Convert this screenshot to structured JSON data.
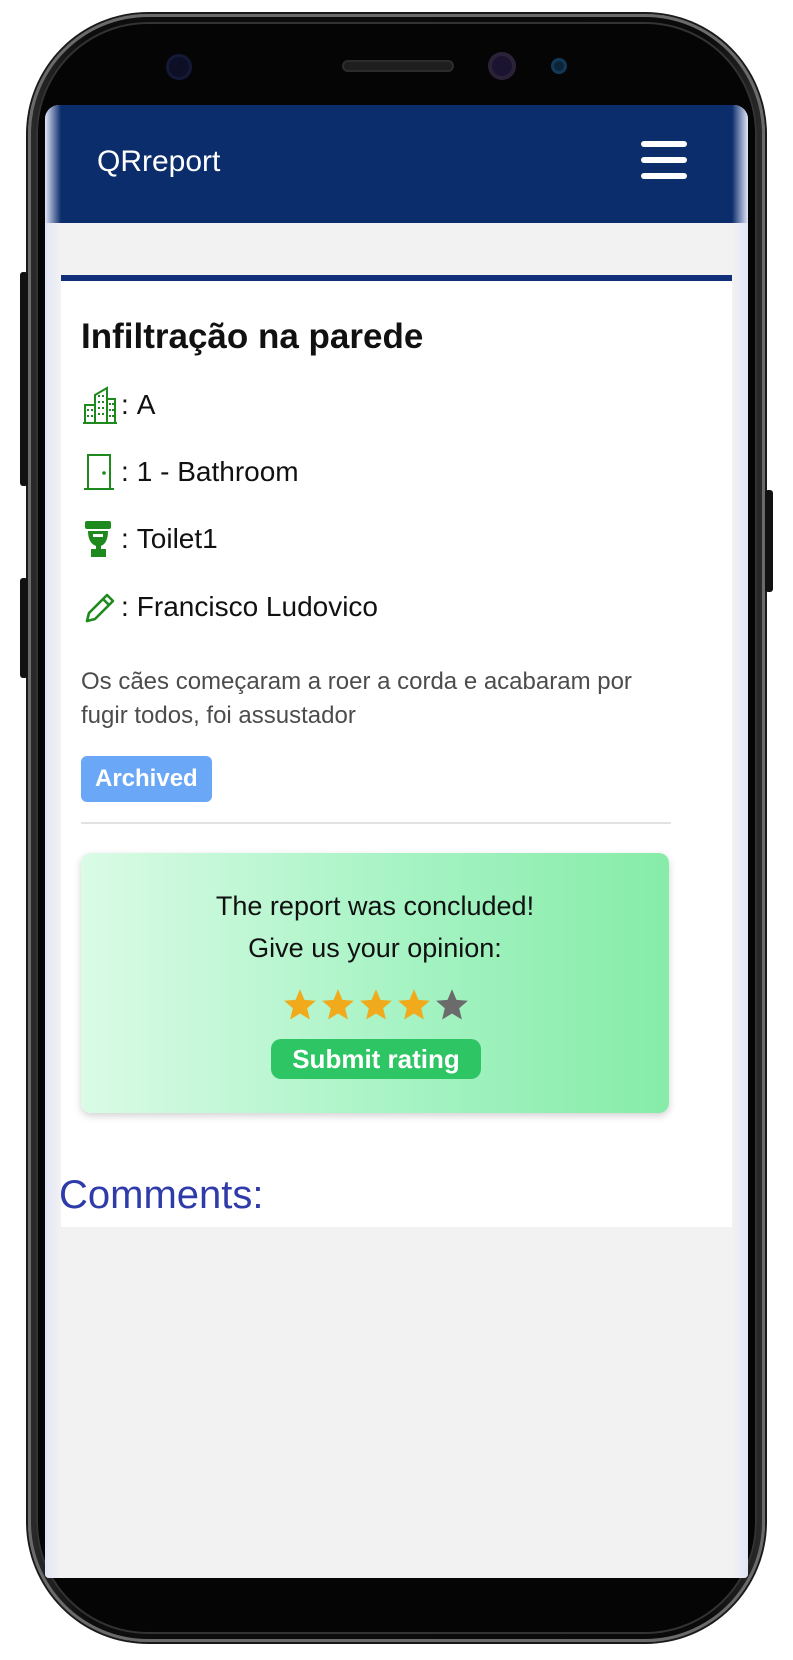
{
  "navbar": {
    "brand": "QRreport",
    "menu_icon": "hamburger-menu-icon"
  },
  "report": {
    "title": "Infiltração na parede",
    "fields": [
      {
        "icon": "building-icon",
        "separator": ":",
        "value": "A"
      },
      {
        "icon": "door-icon",
        "separator": ":",
        "value": "1 - Bathroom"
      },
      {
        "icon": "toilet-icon",
        "separator": ":",
        "value": "Toilet1"
      },
      {
        "icon": "pencil-icon",
        "separator": ":",
        "value": "Francisco Ludovico"
      }
    ],
    "description": "Os cães começaram a roer a corda e acabaram por fugir todos, foi assustador",
    "status": "Archived"
  },
  "rating": {
    "line1": "The report was concluded!",
    "line2": "Give us your opinion:",
    "stars_selected": 4,
    "stars_total": 5,
    "submit_label": "Submit rating"
  },
  "comments": {
    "title": "Comments:"
  },
  "colors": {
    "navbar": "#0c2d6c",
    "accent_border": "#12307a",
    "icon_green": "#1e8a1e",
    "badge_blue": "#6aa8f7",
    "star_filled": "#f0aa1c",
    "star_empty": "#6b6b6b",
    "submit_green": "#2ec565",
    "comments_title": "#2e3ba9"
  }
}
